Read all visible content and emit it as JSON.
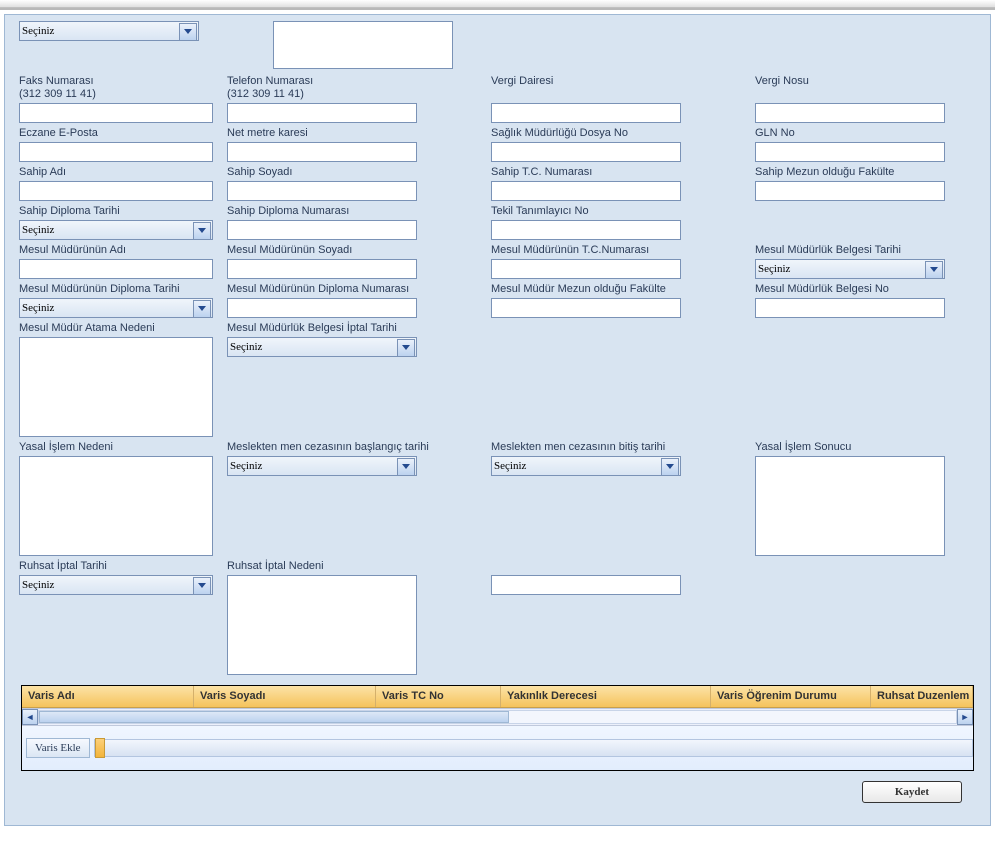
{
  "top_select": {
    "value": "Seçiniz"
  },
  "row1": {
    "faks_label1": "Faks Numarası",
    "faks_label2": "(312 309 11 41)",
    "tel_label1": "Telefon Numarası",
    "tel_label2": "(312 309 11 41)",
    "vergi_dairesi_label": "Vergi Dairesi",
    "vergi_no_label": "Vergi Nosu"
  },
  "row2": {
    "eposta": "Eczane E-Posta",
    "netmetre": "Net metre karesi",
    "saglik_dosya": "Sağlık Müdürlüğü Dosya No",
    "gln": "GLN No"
  },
  "row3": {
    "sahip_adi": "Sahip Adı",
    "sahip_soyadi": "Sahip Soyadı",
    "sahip_tc": "Sahip T.C. Numarası",
    "sahip_fakulte": "Sahip Mezun olduğu Fakülte"
  },
  "row4": {
    "sahip_diploma_tarihi": "Sahip Diploma Tarihi",
    "sahip_diploma_no": "Sahip Diploma Numarası",
    "tekil": "Tekil Tanımlayıcı No",
    "secinizval": "Seçiniz"
  },
  "row5": {
    "mesul_adi": "Mesul Müdürünün Adı",
    "mesul_soyadi": "Mesul Müdürünün Soyadı",
    "mesul_tc": "Mesul Müdürünün T.C.Numarası",
    "mesul_belge_tarihi": "Mesul Müdürlük Belgesi Tarihi",
    "secinizval": "Seçiniz"
  },
  "row6": {
    "mesul_diploma_tarihi": "Mesul Müdürünün Diploma Tarihi",
    "mesul_diploma_no": "Mesul Müdürünün Diploma Numarası",
    "mesul_fakulte": "Mesul Müdür Mezun olduğu Fakülte",
    "mesul_belge_no": "Mesul Müdürlük Belgesi No",
    "secinizval": "Seçiniz"
  },
  "row7": {
    "atama_nedeni": "Mesul Müdür Atama Nedeni",
    "belge_iptal_tarihi": "Mesul Müdürlük Belgesi İptal Tarihi",
    "secinizval": "Seçiniz"
  },
  "row8": {
    "yasal_islem_nedeni": "Yasal İşlem Nedeni",
    "men_baslangic": "Meslekten men cezasının başlangıç tarihi",
    "men_bitis": "Meslekten men cezasının bitiş tarihi",
    "yasal_islem_sonucu": "Yasal İşlem Sonucu",
    "secinizval": "Seçiniz"
  },
  "row9": {
    "ruhsat_iptal_tarihi": "Ruhsat İptal Tarihi",
    "ruhsat_iptal_nedeni": "Ruhsat İptal Nedeni",
    "secinizval": "Seçiniz"
  },
  "table": {
    "headers": {
      "varis_adi": "Varis Adı",
      "varis_soyadi": "Varis Soyadı",
      "varis_tc": "Varis TC No",
      "yakinlik": "Yakınlık Derecesi",
      "ogrenim": "Varis Öğrenim Durumu",
      "ruhsat_duz": "Ruhsat Duzenlem"
    },
    "varis_ekle": "Varis Ekle"
  },
  "footer": {
    "kaydet": "Kaydet"
  }
}
